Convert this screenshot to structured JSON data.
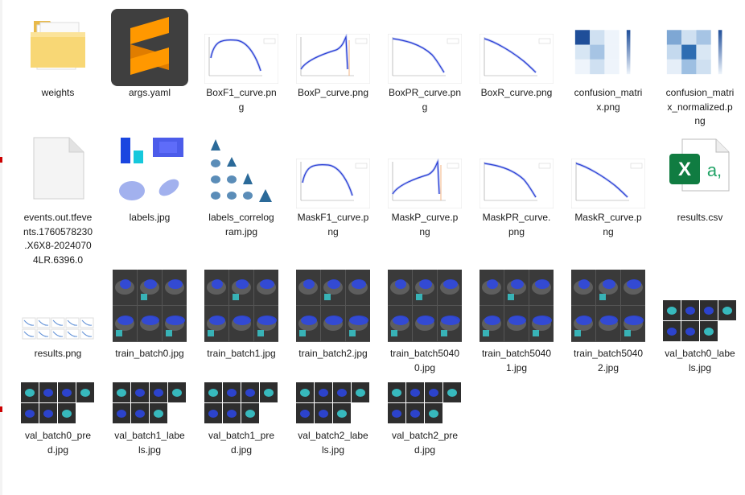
{
  "files": [
    {
      "name": "weights",
      "kind": "folder",
      "lines": [
        "weights"
      ]
    },
    {
      "name": "args.yaml",
      "kind": "sublime",
      "lines": [
        "args.yaml"
      ]
    },
    {
      "name": "BoxF1_curve.png",
      "kind": "curve-f1",
      "lines": [
        "BoxF1_curve.pn",
        "g"
      ]
    },
    {
      "name": "BoxP_curve.png",
      "kind": "curve-p",
      "lines": [
        "BoxP_curve.png"
      ]
    },
    {
      "name": "BoxPR_curve.png",
      "kind": "curve-pr",
      "lines": [
        "BoxPR_curve.pn",
        "g"
      ]
    },
    {
      "name": "BoxR_curve.png",
      "kind": "curve-r",
      "lines": [
        "BoxR_curve.png"
      ]
    },
    {
      "name": "confusion_matrix.png",
      "kind": "confusion",
      "lines": [
        "confusion_matri",
        "x.png"
      ]
    },
    {
      "name": "confusion_matrix_normalized.png",
      "kind": "confusion-norm",
      "lines": [
        "confusion_matri",
        "x_normalized.p",
        "ng"
      ]
    },
    {
      "name": "events.out.tfevents.1760578230.X6X8-20240704LR.6396.0",
      "kind": "blank-file",
      "lines": [
        "events.out.tfeve",
        "nts.1760578230",
        ".X6X8-2024070",
        "4LR.6396.0"
      ]
    },
    {
      "name": "labels.jpg",
      "kind": "labels",
      "lines": [
        "labels.jpg"
      ]
    },
    {
      "name": "labels_correlogram.jpg",
      "kind": "correlogram",
      "lines": [
        "labels_correlog",
        "ram.jpg"
      ]
    },
    {
      "name": "MaskF1_curve.png",
      "kind": "curve-f1",
      "lines": [
        "MaskF1_curve.p",
        "ng"
      ]
    },
    {
      "name": "MaskP_curve.png",
      "kind": "curve-p",
      "lines": [
        "MaskP_curve.p",
        "ng"
      ]
    },
    {
      "name": "MaskPR_curve.png",
      "kind": "curve-pr",
      "lines": [
        "MaskPR_curve.",
        "png"
      ]
    },
    {
      "name": "MaskR_curve.png",
      "kind": "curve-r",
      "lines": [
        "MaskR_curve.p",
        "ng"
      ]
    },
    {
      "name": "results.csv",
      "kind": "excel",
      "lines": [
        "results.csv"
      ]
    },
    {
      "name": "results.png",
      "kind": "results",
      "lines": [
        "results.png"
      ]
    },
    {
      "name": "train_batch0.jpg",
      "kind": "train",
      "lines": [
        "train_batch0.jpg"
      ]
    },
    {
      "name": "train_batch1.jpg",
      "kind": "train",
      "lines": [
        "train_batch1.jpg"
      ]
    },
    {
      "name": "train_batch2.jpg",
      "kind": "train",
      "lines": [
        "train_batch2.jpg"
      ]
    },
    {
      "name": "train_batch50400.jpg",
      "kind": "train",
      "lines": [
        "train_batch5040",
        "0.jpg"
      ]
    },
    {
      "name": "train_batch50401.jpg",
      "kind": "train",
      "lines": [
        "train_batch5040",
        "1.jpg"
      ]
    },
    {
      "name": "train_batch50402.jpg",
      "kind": "train",
      "lines": [
        "train_batch5040",
        "2.jpg"
      ]
    },
    {
      "name": "val_batch0_labels.jpg",
      "kind": "val",
      "lines": [
        "val_batch0_labe",
        "ls.jpg"
      ]
    },
    {
      "name": "val_batch0_pred.jpg",
      "kind": "val",
      "lines": [
        "val_batch0_pre",
        "d.jpg"
      ]
    },
    {
      "name": "val_batch1_labels.jpg",
      "kind": "val",
      "lines": [
        "val_batch1_labe",
        "ls.jpg"
      ]
    },
    {
      "name": "val_batch1_pred.jpg",
      "kind": "val",
      "lines": [
        "val_batch1_pre",
        "d.jpg"
      ]
    },
    {
      "name": "val_batch2_labels.jpg",
      "kind": "val",
      "lines": [
        "val_batch2_labe",
        "ls.jpg"
      ]
    },
    {
      "name": "val_batch2_pred.jpg",
      "kind": "val",
      "lines": [
        "val_batch2_pre",
        "d.jpg"
      ]
    }
  ],
  "colors": {
    "folder": "#f8d775",
    "sublime_bg": "#3f3f3f",
    "sublime_logo": "#ff9800",
    "excel": "#107c41",
    "curve_line": "#2b3fd6",
    "heat_dark": "#1f4e99",
    "ultrasound_overlay": "#2b46e8",
    "ultrasound_cyan": "#38d1d6"
  }
}
